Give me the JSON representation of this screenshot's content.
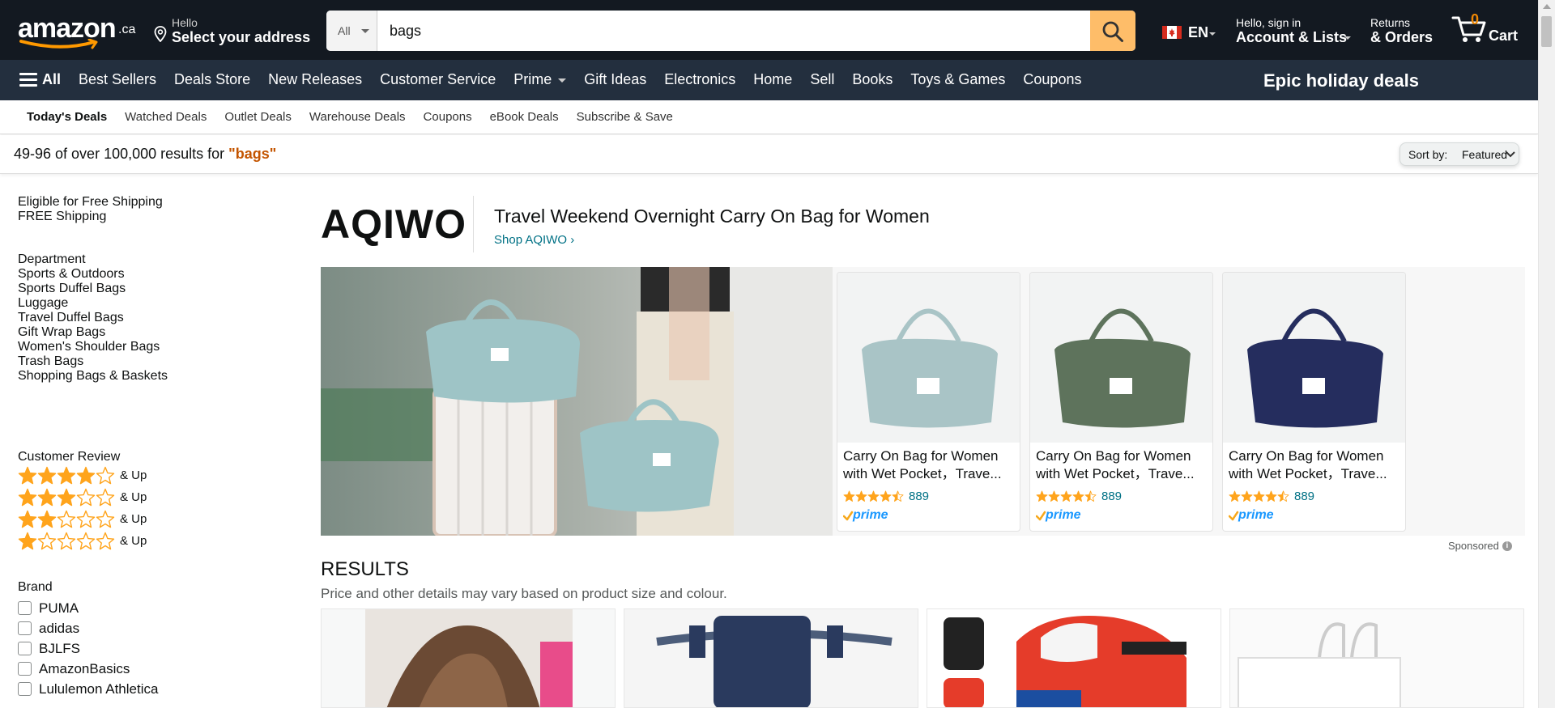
{
  "header": {
    "logo_word": "amazon",
    "logo_tld": ".ca",
    "deliver_line1": "Hello",
    "deliver_line2": "Select your address",
    "search_category": "All",
    "search_value": "bags",
    "language": "EN",
    "account_line1": "Hello, sign in",
    "account_line2": "Account & Lists",
    "orders_line1": "Returns",
    "orders_line2": "& Orders",
    "cart_count": "0",
    "cart_label": "Cart"
  },
  "nav": {
    "all_label": "All",
    "links": [
      "Best Sellers",
      "Deals Store",
      "New Releases",
      "Customer Service",
      "Prime",
      "Gift Ideas",
      "Electronics",
      "Home",
      "Sell",
      "Books",
      "Toys & Games",
      "Coupons"
    ],
    "promo": "Epic holiday deals"
  },
  "subnav": {
    "items": [
      "Today's Deals",
      "Watched Deals",
      "Outlet Deals",
      "Warehouse Deals",
      "Coupons",
      "eBook Deals",
      "Subscribe & Save"
    ]
  },
  "results_bar": {
    "count_text": "49-96 of over 100,000 results for ",
    "query": "\"bags\"",
    "sort_label": "Sort by:",
    "sort_value": "Featured"
  },
  "sidebar": {
    "shipping_heading": "Eligible for Free Shipping",
    "shipping_option": "FREE Shipping",
    "department_heading": "Department",
    "departments": [
      {
        "label": "Sports & Outdoors",
        "indent": false
      },
      {
        "label": "Sports Duffel Bags",
        "indent": true
      },
      {
        "label": "Luggage",
        "indent": false
      },
      {
        "label": "Travel Duffel Bags",
        "indent": true
      },
      {
        "label": "Gift Wrap Bags",
        "indent": false
      },
      {
        "label": "Women's Shoulder Bags",
        "indent": false
      },
      {
        "label": "Trash Bags",
        "indent": false
      },
      {
        "label": "Shopping Bags & Baskets",
        "indent": false
      }
    ],
    "review_heading": "Customer Review",
    "review_filters": [
      {
        "stars": 4,
        "label": "& Up"
      },
      {
        "stars": 3,
        "label": "& Up"
      },
      {
        "stars": 2,
        "label": "& Up"
      },
      {
        "stars": 1,
        "label": "& Up"
      }
    ],
    "brand_heading": "Brand",
    "brands": [
      "PUMA",
      "adidas",
      "BJLFS",
      "AmazonBasics",
      "Lululemon Athletica"
    ]
  },
  "sponsored_brand": {
    "brand_logo": "AQIWO",
    "headline": "Travel Weekend Overnight Carry On Bag for Women",
    "shop_link": "Shop AQIWO ›",
    "products": [
      {
        "title": "Carry On Bag for Women with Wet Pocket，Trave...",
        "rating": 4.5,
        "reviews": "889",
        "color": "#a9c4c6"
      },
      {
        "title": "Carry On Bag for Women with Wet Pocket，Trave...",
        "rating": 4.5,
        "reviews": "889",
        "color": "#5e735c"
      },
      {
        "title": "Carry On Bag for Women with Wet Pocket，Trave...",
        "rating": 4.5,
        "reviews": "889",
        "color": "#252d5e"
      }
    ],
    "sponsored_label": "Sponsored",
    "prime_label": "prime"
  },
  "results": {
    "heading": "RESULTS",
    "subheading": "Price and other details may vary based on product size and colour."
  },
  "colors": {
    "header_bg": "#131921",
    "nav_bg": "#232f3e",
    "search_button": "#febd69",
    "star": "#ffa41c",
    "link": "#007185",
    "query": "#c45500",
    "cart_count": "#f08804"
  }
}
